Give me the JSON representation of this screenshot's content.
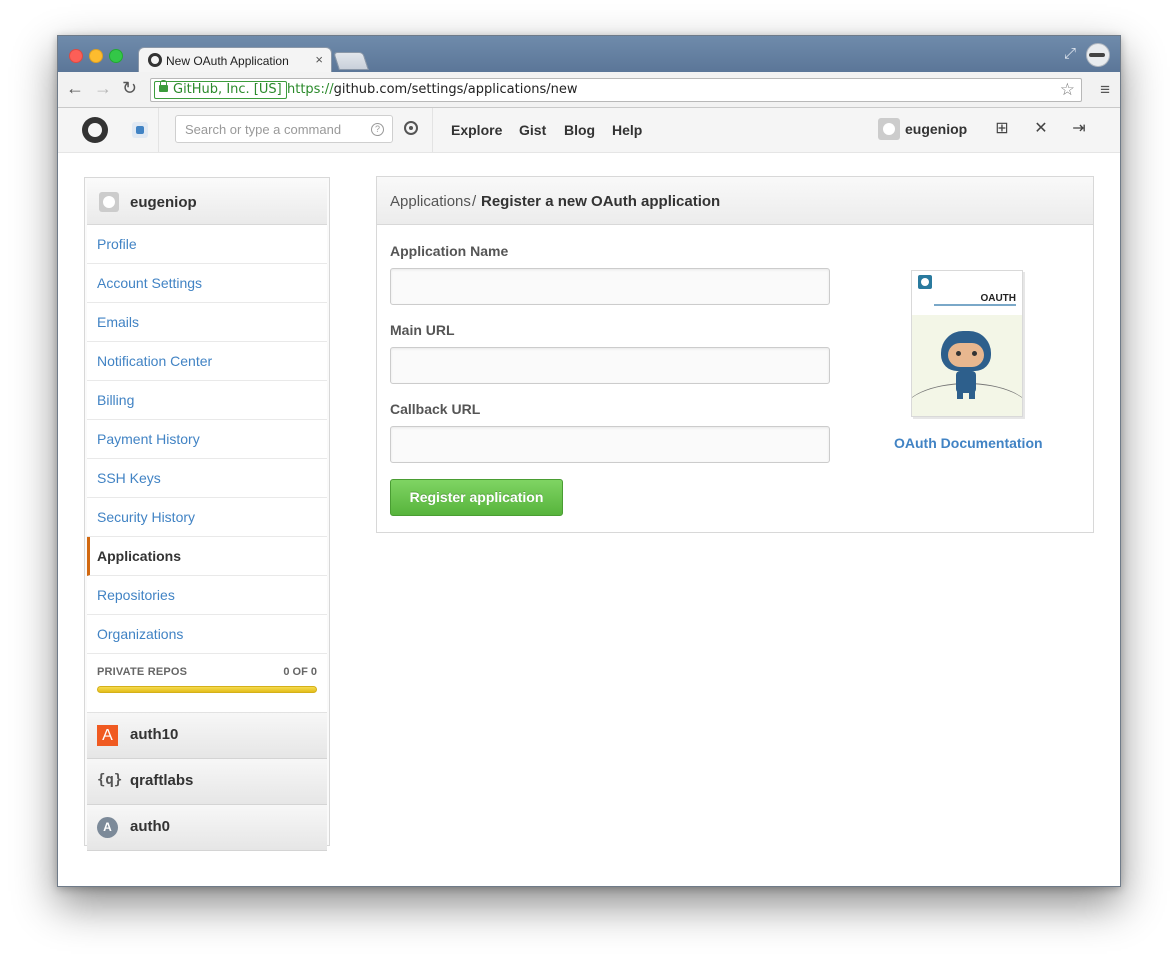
{
  "browser": {
    "tab_title": "New OAuth Application",
    "tab_close": "×",
    "ev_label": "GitHub, Inc. [US]",
    "url_scheme": "https://",
    "url_rest": "github.com/settings/applications/new",
    "nav": {
      "back": "←",
      "forward": "→",
      "reload": "↻"
    },
    "star": "☆",
    "menu": "≡",
    "fullscreen": "⤢"
  },
  "header": {
    "search_placeholder": "Search or type a command",
    "search_help": "?",
    "nav": [
      "Explore",
      "Gist",
      "Blog",
      "Help"
    ],
    "username": "eugeniop",
    "icons": [
      "new-repo-icon",
      "settings-tools-icon",
      "sign-out-icon"
    ],
    "icon_glyphs": {
      "new_repo": "⊞",
      "tools": "✕",
      "sign_out": "⇥"
    }
  },
  "sidebar": {
    "user": "eugeniop",
    "items": [
      "Profile",
      "Account Settings",
      "Emails",
      "Notification Center",
      "Billing",
      "Payment History",
      "SSH Keys",
      "Security History",
      "Applications",
      "Repositories",
      "Organizations"
    ],
    "active_item": "Applications",
    "private_repos_label": "PRIVATE REPOS",
    "private_repos_count": "0 OF 0",
    "orgs": [
      {
        "name": "auth10",
        "icon": "A"
      },
      {
        "name": "qraftlabs",
        "icon": "{q}"
      },
      {
        "name": "auth0",
        "icon": "A"
      }
    ]
  },
  "main": {
    "breadcrumb_parent": "Applications",
    "breadcrumb_sep": "/",
    "breadcrumb_current": "Register a new OAuth application",
    "fields": [
      {
        "label": "Application Name",
        "value": ""
      },
      {
        "label": "Main URL",
        "value": ""
      },
      {
        "label": "Callback URL",
        "value": ""
      }
    ],
    "submit_label": "Register application",
    "book_title": "OAUTH",
    "doc_link": "OAuth Documentation"
  },
  "colors": {
    "link": "#4183c4",
    "active_marker": "#d26911",
    "button_green": "#57b43c",
    "repos_bar": "#e3bd1a"
  }
}
